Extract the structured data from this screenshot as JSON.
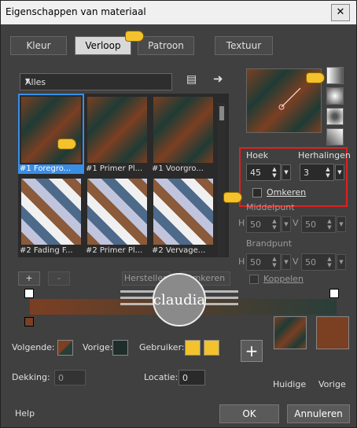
{
  "title": "Eigenschappen van materiaal",
  "tabs": [
    "Kleur",
    "Verloop",
    "Patroon",
    "Textuur"
  ],
  "gallery": {
    "filter": "Alles",
    "items": [
      "#1 Foregro...",
      "#1 Primer Pl...",
      "#1 Voorgro...",
      "#2 Fading F...",
      "#2 Primer Pl...",
      "#2 Vervage..."
    ]
  },
  "angle": {
    "label": "Hoek",
    "value": "45"
  },
  "repeats": {
    "label": "Herhalingen",
    "value": "3"
  },
  "invert": "Omkeren",
  "center": {
    "label": "Middelpunt",
    "h": "H",
    "hval": "50",
    "v": "V",
    "vval": "50"
  },
  "focal": {
    "label": "Brandpunt",
    "h": "H",
    "hval": "50",
    "v": "V",
    "vval": "50",
    "link": "Koppelen"
  },
  "stop_buttons": [
    "+",
    "-",
    "Herstellen",
    "Omkeren"
  ],
  "colors": {
    "next_label": "Volgende:",
    "prev_label": "Vorige:",
    "user_label": "Gebruiker:",
    "opacity_label": "Dekking:",
    "opacity": "0",
    "location_label": "Locatie:",
    "location": "0",
    "accent": "#3a8ee6",
    "highlight": "#e02020"
  },
  "previews": {
    "current": "Huidige",
    "previous": "Vorige"
  },
  "footer": {
    "help": "Help",
    "ok": "OK",
    "cancel": "Annuleren"
  },
  "watermark": "claudia"
}
